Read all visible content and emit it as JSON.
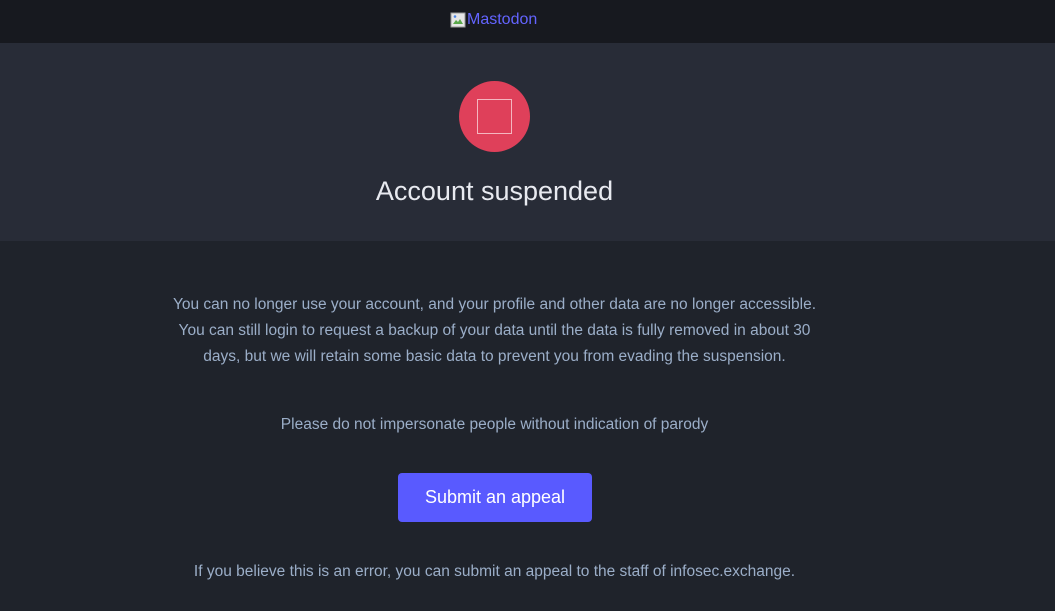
{
  "header": {
    "logo_alt": "Mastodon"
  },
  "hero": {
    "icon": "suspended-square-icon",
    "title": "Account suspended"
  },
  "content": {
    "description": "You can no longer use your account, and your profile and other data are no longer accessible. You can still login to request a backup of your data until the data is fully removed in about 30 days, but we will retain some basic data to prevent you from evading the suspension.",
    "reason": "Please do not impersonate people without indication of parody",
    "appeal_button": "Submit an appeal",
    "footer_note": "If you believe this is an error, you can submit an appeal to the staff of infosec.exchange."
  },
  "colors": {
    "topbar_bg": "#17191f",
    "hero_bg": "#282c37",
    "page_bg": "#1f232b",
    "danger": "#df405a",
    "accent": "#595aff",
    "link": "#6364ff",
    "text_muted": "#9baec8",
    "text_primary": "#e8eaf0"
  }
}
